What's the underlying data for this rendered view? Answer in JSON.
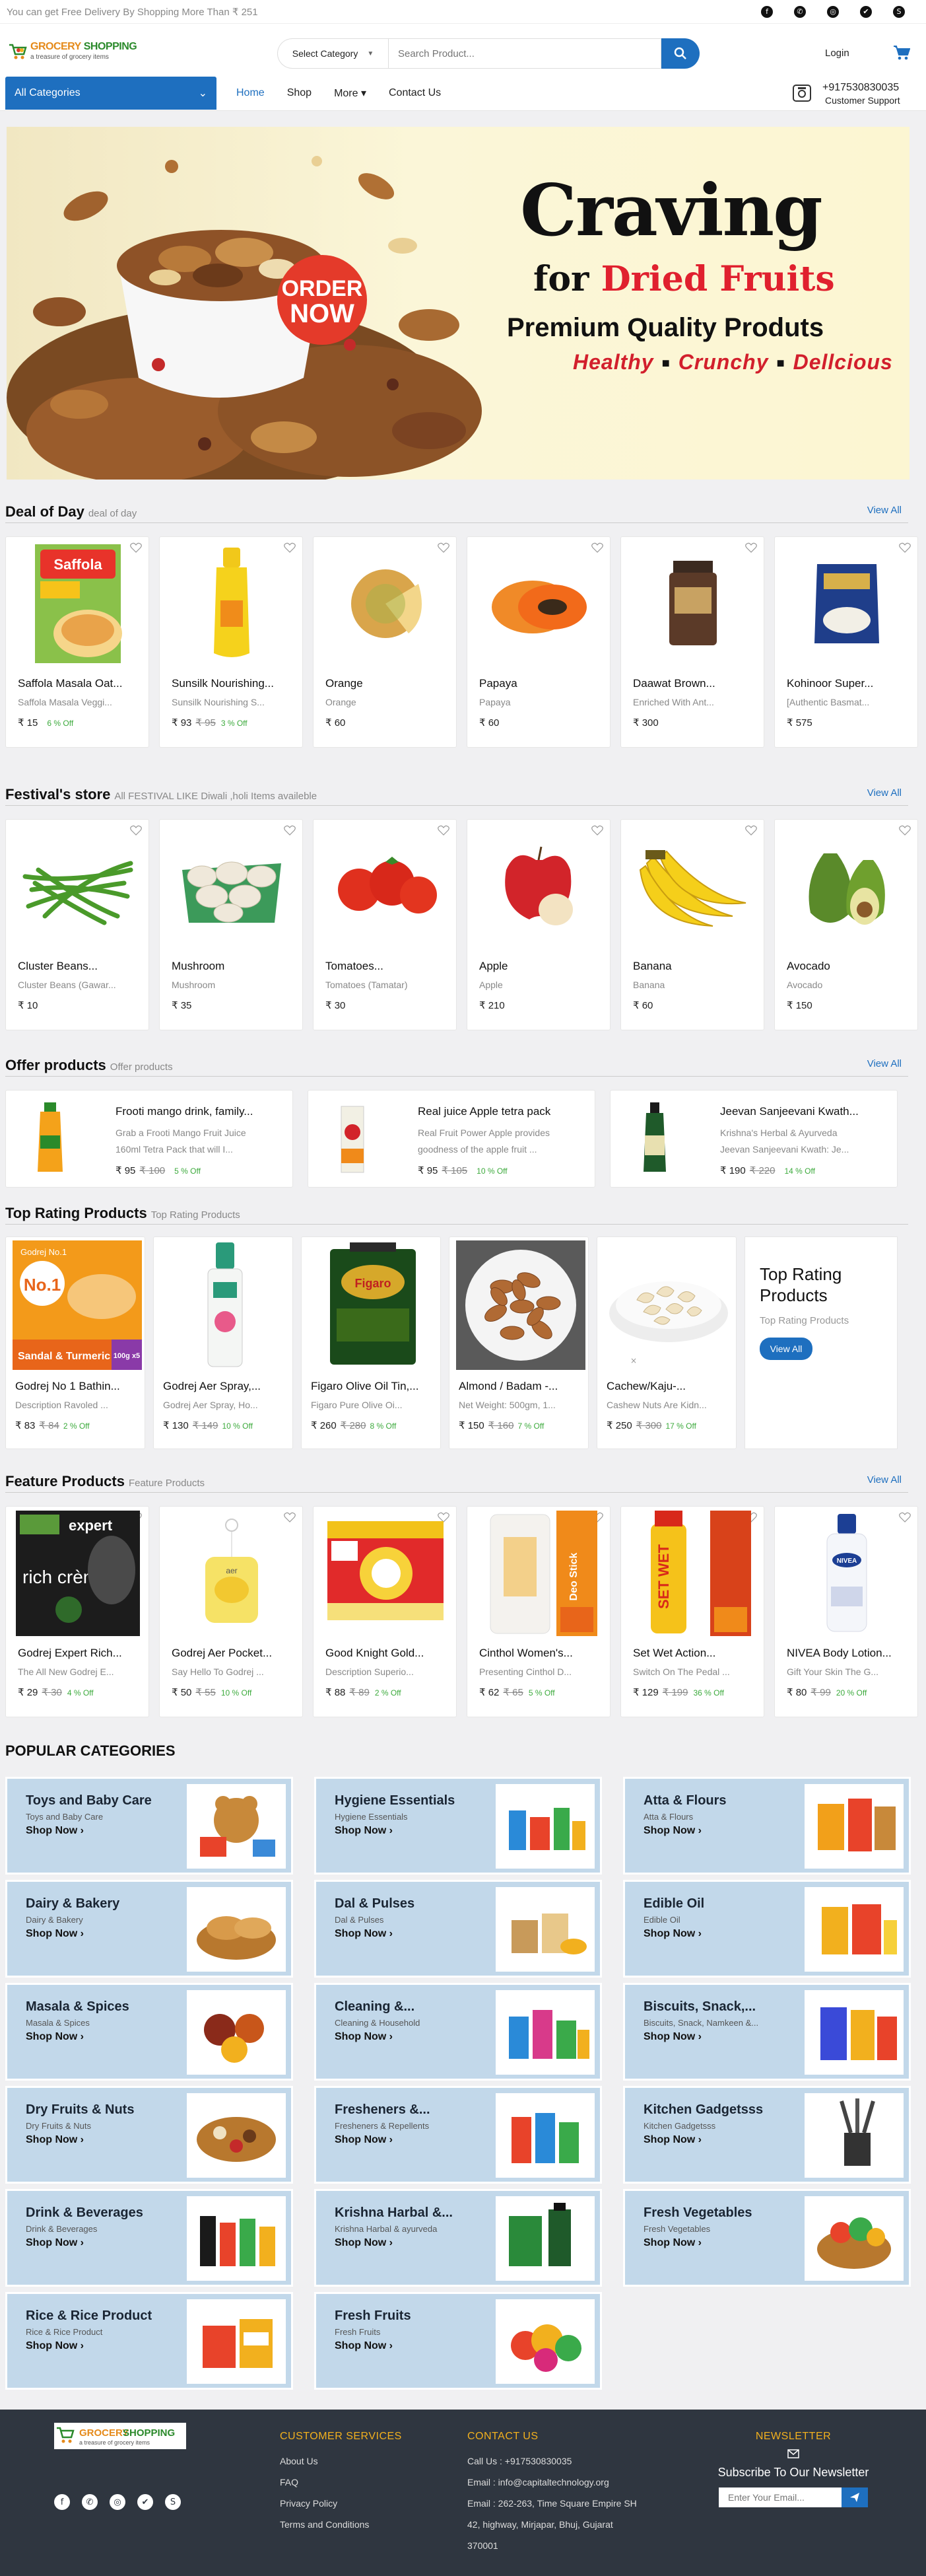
{
  "topbar": {
    "message": "You can get Free Delivery By Shopping More Than ₹ 251"
  },
  "social_icons": [
    "facebook-icon",
    "whatsapp-icon",
    "instagram-icon",
    "twitter-icon",
    "skype-icon"
  ],
  "logo": {
    "name_a": "GROCERY",
    "name_b": " SHOPPING",
    "tagline": "a treasure of grocery items"
  },
  "search": {
    "category": "Select Category",
    "placeholder": "Search Product..."
  },
  "header": {
    "login": "Login",
    "all_categories": "All Categories",
    "phone": "+917530830035",
    "support": "Customer Support"
  },
  "nav": [
    {
      "label": "Home"
    },
    {
      "label": "Shop"
    },
    {
      "label": "More"
    },
    {
      "label": "Contact Us"
    }
  ],
  "banner": {
    "title": "Craving",
    "for": "for ",
    "subject": "Dried Fruits",
    "line2": "Premium Quality Produts",
    "tags": [
      "Healthy",
      "Crunchy",
      "Dellcious"
    ],
    "badge_1": "ORDER",
    "badge_2": "NOW"
  },
  "deal": {
    "title": "Deal of Day",
    "sub": "deal of day",
    "view_all": "View All",
    "items": [
      {
        "name": "Saffola Masala Oat...",
        "desc": "Saffola Masala Veggi...",
        "price": "₹ 15",
        "old": "",
        "off": "6 % Off"
      },
      {
        "name": "Sunsilk Nourishing...",
        "desc": "Sunsilk Nourishing S...",
        "price": "₹ 93",
        "old": "₹ 95",
        "off": "3 % Off"
      },
      {
        "name": "Orange",
        "desc": "Orange",
        "price": "₹ 60",
        "old": "",
        "off": ""
      },
      {
        "name": "Papaya",
        "desc": "Papaya",
        "price": "₹ 60",
        "old": "",
        "off": ""
      },
      {
        "name": "Daawat Brown...",
        "desc": "Enriched With Ant...",
        "price": "₹ 300",
        "old": "",
        "off": ""
      },
      {
        "name": "Kohinoor Super...",
        "desc": "[Authentic Basmat...",
        "price": "₹ 575",
        "old": "",
        "off": ""
      }
    ]
  },
  "festival": {
    "title": "Festival's store",
    "sub": "All FESTIVAL LIKE Diwali ,holi Items availeble",
    "view_all": "View All",
    "items": [
      {
        "name": "Cluster Beans...",
        "desc": "Cluster Beans (Gawar...",
        "price": "₹ 10",
        "old": "",
        "off": ""
      },
      {
        "name": "Mushroom",
        "desc": "Mushroom",
        "price": "₹ 35",
        "old": "",
        "off": ""
      },
      {
        "name": "Tomatoes...",
        "desc": "Tomatoes (Tamatar)",
        "price": "₹ 30",
        "old": "",
        "off": ""
      },
      {
        "name": "Apple",
        "desc": "Apple",
        "price": "₹ 210",
        "old": "",
        "off": ""
      },
      {
        "name": "Banana",
        "desc": "Banana",
        "price": "₹ 60",
        "old": "",
        "off": ""
      },
      {
        "name": "Avocado",
        "desc": "Avocado",
        "price": "₹ 150",
        "old": "",
        "off": ""
      }
    ]
  },
  "offers": {
    "title": "Offer products",
    "sub": "Offer products",
    "view_all": "View All",
    "items": [
      {
        "name": "Frooti mango drink, family...",
        "desc_1": "Grab a Frooti Mango Fruit Juice",
        "desc_2": "160ml Tetra Pack that will I...",
        "price": "₹ 95",
        "old": "₹ 100",
        "off": "5 % Off"
      },
      {
        "name": "Real juice Apple tetra pack",
        "desc_1": "Real Fruit Power Apple provides",
        "desc_2": "goodness of the apple fruit ...",
        "price": "₹ 95",
        "old": "₹ 105",
        "off": "10 % Off"
      },
      {
        "name": "Jeevan Sanjeevani Kwath...",
        "desc_1": "Krishna's Herbal & Ayurveda",
        "desc_2": "Jeevan Sanjeevani Kwath: Je...",
        "price": "₹ 190",
        "old": "₹ 220",
        "off": "14 % Off"
      }
    ]
  },
  "top_rating": {
    "title": "Top Rating Products",
    "sub": "Top Rating Products",
    "side_title": "Top Rating Products",
    "side_sub": "Top Rating Products",
    "side_button": "View All",
    "pack_brand": "Godrej No.1",
    "pack_variant": "Sandal & Turmeric",
    "pack_size": "100g x5",
    "items": [
      {
        "name": "Godrej No 1 Bathin...",
        "desc": "Description Ravoled ...",
        "price": "₹ 83",
        "old": "₹ 84",
        "off": "2 % Off"
      },
      {
        "name": "Godrej Aer Spray,...",
        "desc": "Godrej Aer Spray, Ho...",
        "price": "₹ 130",
        "old": "₹ 149",
        "off": "10 % Off"
      },
      {
        "name": "Figaro Olive Oil Tin,...",
        "desc": "Figaro Pure Olive Oi...",
        "price": "₹ 260",
        "old": "₹ 280",
        "off": "8 % Off"
      },
      {
        "name": "Almond / Badam -...",
        "desc": "Net Weight: 500gm, 1...",
        "price": "₹ 150",
        "old": "₹ 160",
        "off": "7 % Off"
      },
      {
        "name": "Cachew/Kaju-...",
        "desc": "Cashew Nuts Are Kidn...",
        "price": "₹ 250",
        "old": "₹ 300",
        "off": "17 % Off"
      }
    ]
  },
  "feature": {
    "title": "Feature Products",
    "sub": "Feature Products",
    "view_all": "View All",
    "hair_brand": "expert",
    "hair_line": "rich crème",
    "items": [
      {
        "name": "Godrej Expert Rich...",
        "desc": "The All New Godrej E...",
        "price": "₹ 29",
        "old": "₹ 30",
        "off": "4 % Off"
      },
      {
        "name": "Godrej Aer Pocket...",
        "desc": "Say Hello To Godrej ...",
        "price": "₹ 50",
        "old": "₹ 55",
        "off": "10 % Off"
      },
      {
        "name": "Good Knight Gold...",
        "desc": "Description Superio...",
        "price": "₹ 88",
        "old": "₹ 89",
        "off": "2 % Off"
      },
      {
        "name": "Cinthol Women's...",
        "desc": "Presenting Cinthol D...",
        "price": "₹ 62",
        "old": "₹ 65",
        "off": "5 % Off"
      },
      {
        "name": "Set Wet Action...",
        "desc": "Switch On The Pedal ...",
        "price": "₹ 129",
        "old": "₹ 199",
        "off": "36 % Off"
      },
      {
        "name": "NIVEA Body Lotion...",
        "desc": "Gift Your Skin The G...",
        "price": "₹ 80",
        "old": "₹ 99",
        "off": "20 % Off"
      }
    ]
  },
  "popular": {
    "title": "POPULAR CATEGORIES",
    "shop_now": "Shop Now",
    "items": [
      {
        "name": "Toys and Baby Care",
        "sub": "Toys and Baby Care"
      },
      {
        "name": "Hygiene Essentials",
        "sub": "Hygiene Essentials"
      },
      {
        "name": "Atta & Flours",
        "sub": "Atta & Flours"
      },
      {
        "name": "Dairy & Bakery",
        "sub": "Dairy & Bakery"
      },
      {
        "name": "Dal & Pulses",
        "sub": "Dal & Pulses"
      },
      {
        "name": "Edible Oil",
        "sub": "Edible Oil"
      },
      {
        "name": "Masala & Spices",
        "sub": "Masala & Spices"
      },
      {
        "name": "Cleaning &...",
        "sub": "Cleaning & Household"
      },
      {
        "name": "Biscuits, Snack,...",
        "sub": "Biscuits, Snack, Namkeen &..."
      },
      {
        "name": "Dry Fruits & Nuts",
        "sub": "Dry Fruits & Nuts"
      },
      {
        "name": "Fresheners &...",
        "sub": "Fresheners & Repellents"
      },
      {
        "name": "Kitchen Gadgetsss",
        "sub": "Kitchen Gadgetsss"
      },
      {
        "name": "Drink & Beverages",
        "sub": "Drink & Beverages"
      },
      {
        "name": "Krishna Harbal &...",
        "sub": "Krishna Harbal & ayurveda"
      },
      {
        "name": "Fresh Vegetables",
        "sub": "Fresh Vegetables"
      },
      {
        "name": "Rice & Rice Product",
        "sub": "Rice & Rice Product"
      },
      {
        "name": "Fresh Fruits",
        "sub": "Fresh Fruits"
      }
    ]
  },
  "footer": {
    "customer_title": "CUSTOMER SERVICES",
    "links": [
      "About Us",
      "FAQ",
      "Privacy Policy",
      "Terms and Conditions"
    ],
    "contact_title": "CONTACT US",
    "contact_lines": [
      "Call Us : +917530830035",
      "Email : info@capitaltechnology.org",
      "Email : 262-263, Time Square Empire SH",
      "42, highway, Mirjapar, Bhuj, Gujarat",
      "370001"
    ],
    "newsletter_title": "NEWSLETTER",
    "newsletter_sub": "Subscribe To Our Newsletter",
    "email_placeholder": "Enter Your Email..."
  },
  "colors": {
    "primary": "#1e6fbf",
    "green": "#3caa3c",
    "footer": "#2f3640",
    "accent": "#f2b01e",
    "category_bg": "#c2d8ea"
  }
}
